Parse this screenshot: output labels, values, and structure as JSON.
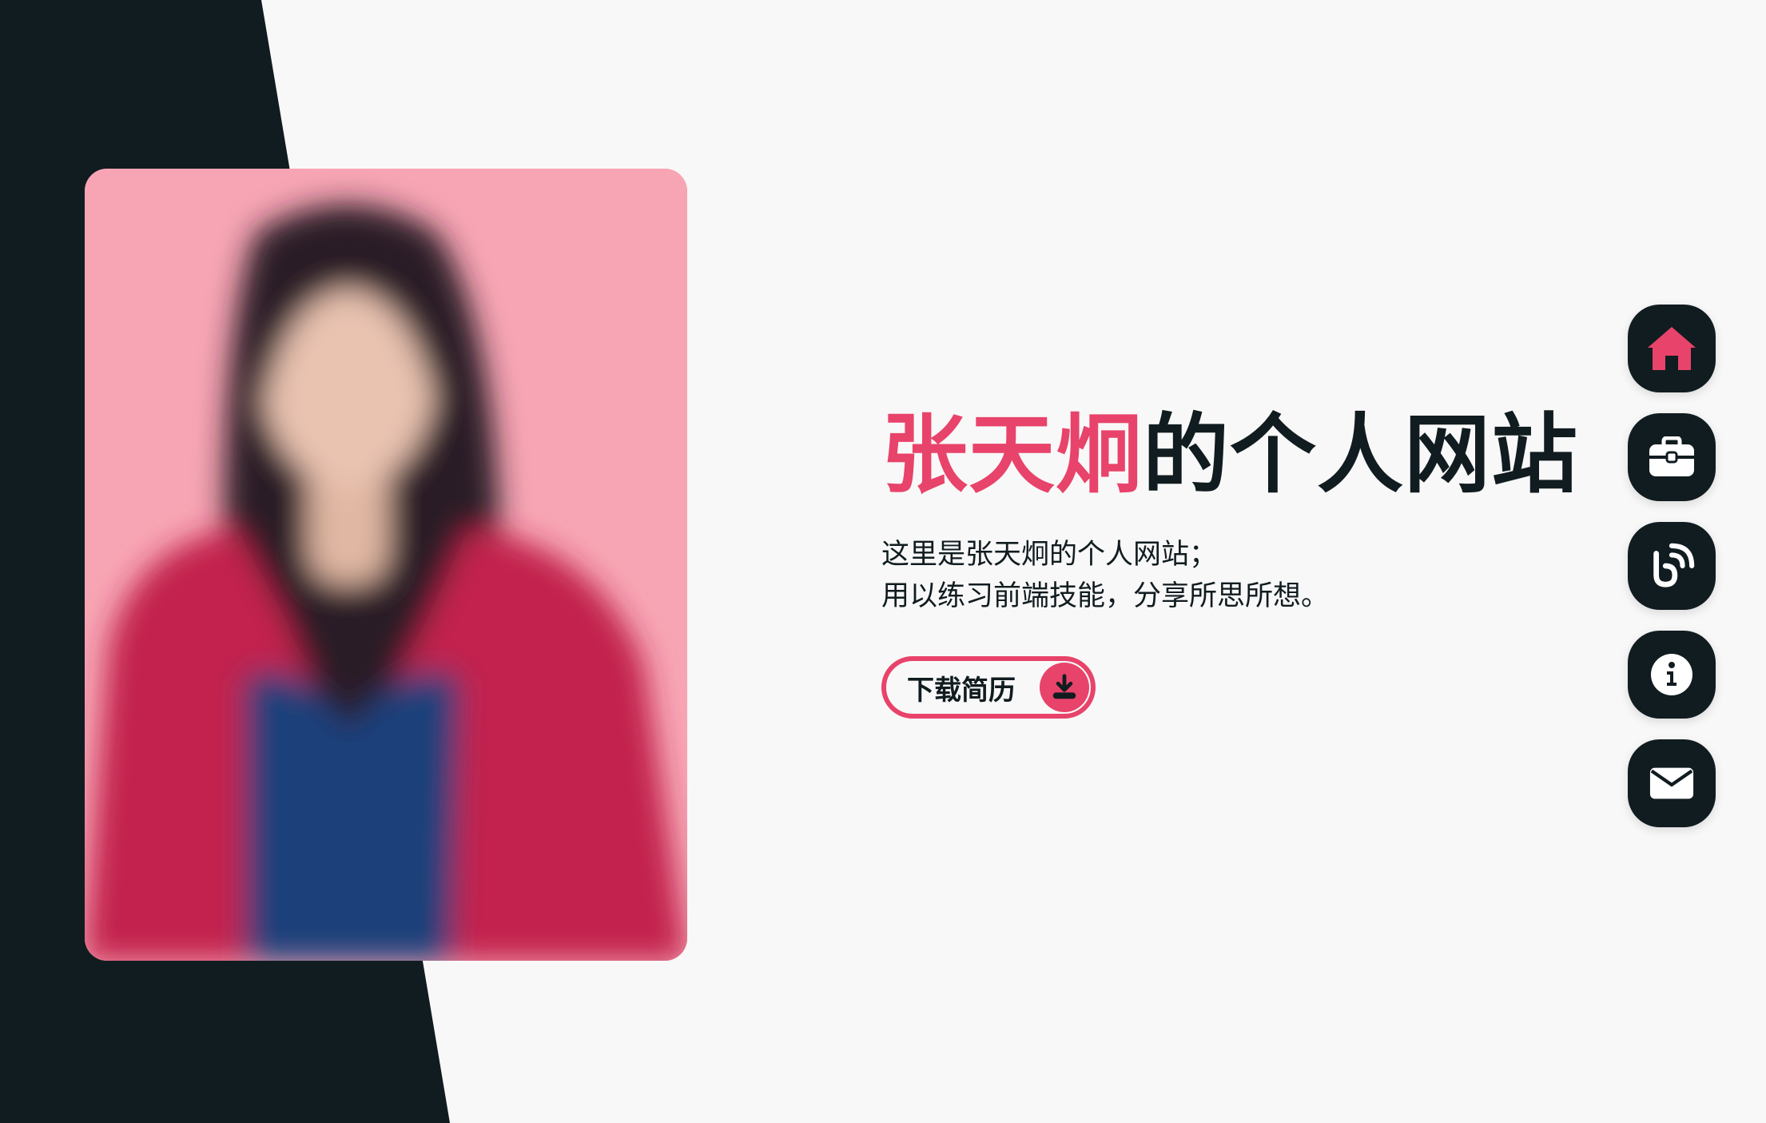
{
  "hero": {
    "title_name": "张天炯",
    "title_suffix": "的个人网站",
    "desc_line1": "这里是张天炯的个人网站；",
    "desc_line2": "用以练习前端技能，分享所思所想。",
    "download_label": "下载简历"
  },
  "nav": {
    "items": [
      {
        "icon": "home-icon",
        "active": true
      },
      {
        "icon": "briefcase-icon",
        "active": false
      },
      {
        "icon": "blog-icon",
        "active": false
      },
      {
        "icon": "info-icon",
        "active": false
      },
      {
        "icon": "mail-icon",
        "active": false
      }
    ]
  },
  "colors": {
    "accent": "#e8436a",
    "dark": "#111c20",
    "background": "#f8f8f8",
    "photo_background": "#f7a5b4"
  }
}
